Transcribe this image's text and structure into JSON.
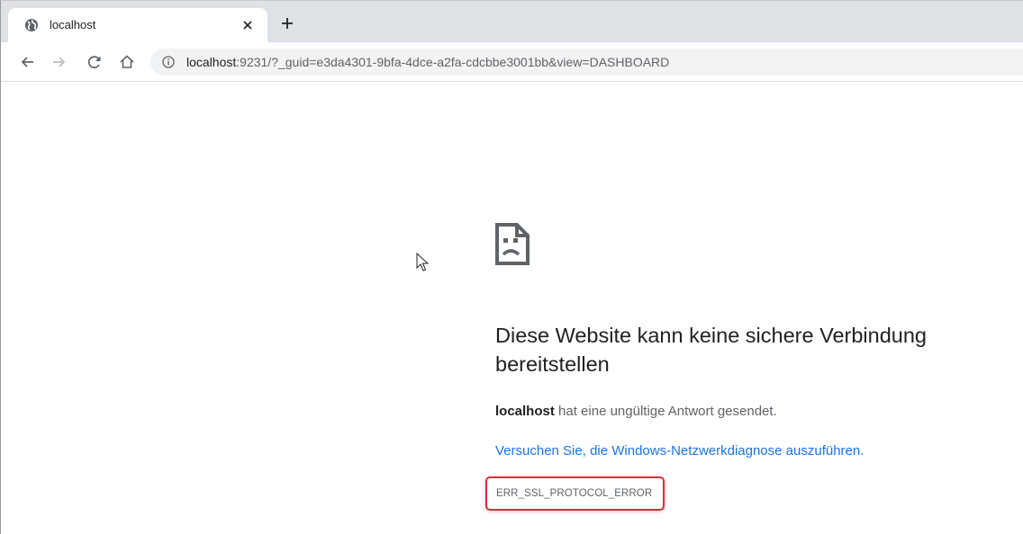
{
  "browser": {
    "tab": {
      "title": "localhost",
      "favicon": "globe-icon"
    },
    "new_tab_icon": "plus-icon",
    "toolbar": {
      "back_icon": "arrow-left-icon",
      "forward_icon": "arrow-right-icon",
      "reload_icon": "reload-icon",
      "home_icon": "home-icon",
      "info_icon": "info-icon"
    },
    "address": {
      "host": "localhost",
      "rest": ":9231/?_guid=e3da4301-9bfa-4dce-a2fa-cdcbbe3001bb&view=DASHBOARD"
    }
  },
  "error_page": {
    "icon": "sad-page-icon",
    "heading": "Diese Website kann keine sichere Verbindung bereitstellen",
    "description_host": "localhost",
    "description_rest": " hat eine ungültige Antwort gesendet.",
    "diagnostics_link": "Versuchen Sie, die Windows-Netzwerkdiagnose auszuführen.",
    "error_code": "ERR_SSL_PROTOCOL_ERROR"
  },
  "colors": {
    "tabstrip": "#dee1e6",
    "link": "#1a73e8",
    "highlight": "#e5293f",
    "text": "#202124",
    "muted": "#5f6368"
  }
}
